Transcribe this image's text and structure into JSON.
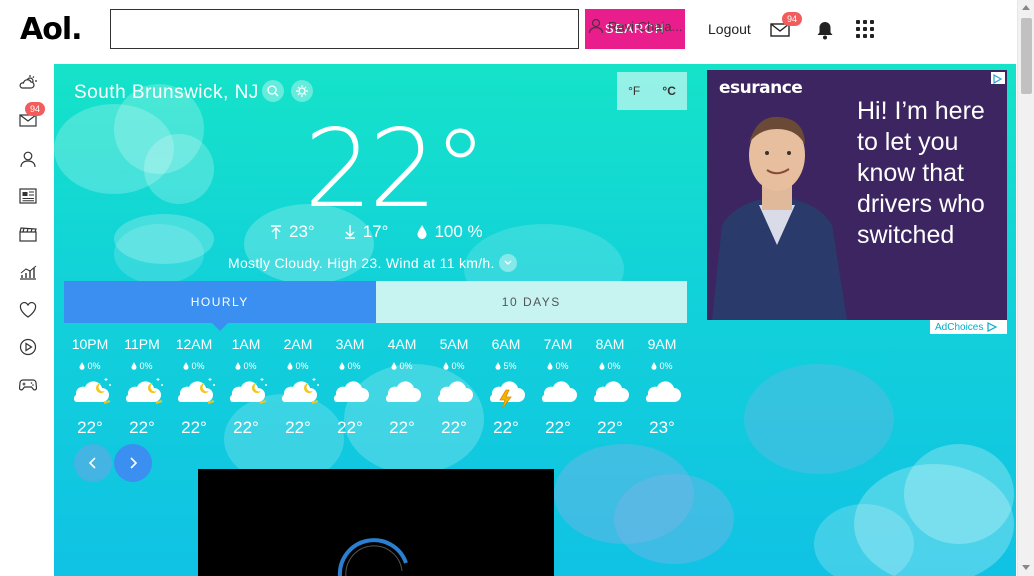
{
  "header": {
    "logo": "Aol.",
    "search_placeholder": "",
    "search_button": "SEARCH",
    "user_name": "Ravi Chaja...",
    "logout": "Logout",
    "mail_count": "94"
  },
  "leftnav": {
    "items": [
      {
        "name": "weather-icon"
      },
      {
        "name": "mail-icon",
        "badge": "94"
      },
      {
        "name": "user-icon"
      },
      {
        "name": "news-icon"
      },
      {
        "name": "entertainment-icon"
      },
      {
        "name": "finance-icon"
      },
      {
        "name": "lifestyle-icon"
      },
      {
        "name": "video-icon"
      },
      {
        "name": "games-icon"
      }
    ]
  },
  "weather": {
    "location": "South Brunswick, NJ",
    "unit_f": "°F",
    "unit_c": "°C",
    "temp": "22°",
    "high": "23°",
    "low": "17°",
    "humidity": "100 %",
    "summary": "Mostly Cloudy. High 23. Wind at 11 km/h.",
    "tabs": [
      {
        "label": "HOURLY",
        "active": true
      },
      {
        "label": "10 DAYS",
        "active": false
      }
    ],
    "hourly": [
      {
        "time": "10PM",
        "precip": "0%",
        "icon": "partly-cloudy-night",
        "temp": "22°"
      },
      {
        "time": "11PM",
        "precip": "0%",
        "icon": "partly-cloudy-night",
        "temp": "22°"
      },
      {
        "time": "12AM",
        "precip": "0%",
        "icon": "partly-cloudy-night",
        "temp": "22°"
      },
      {
        "time": "1AM",
        "precip": "0%",
        "icon": "partly-cloudy-night",
        "temp": "22°"
      },
      {
        "time": "2AM",
        "precip": "0%",
        "icon": "partly-cloudy-night",
        "temp": "22°"
      },
      {
        "time": "3AM",
        "precip": "0%",
        "icon": "cloudy",
        "temp": "22°"
      },
      {
        "time": "4AM",
        "precip": "0%",
        "icon": "cloudy",
        "temp": "22°"
      },
      {
        "time": "5AM",
        "precip": "0%",
        "icon": "cloudy",
        "temp": "22°"
      },
      {
        "time": "6AM",
        "precip": "5%",
        "icon": "thunderstorm",
        "temp": "22°"
      },
      {
        "time": "7AM",
        "precip": "0%",
        "icon": "cloudy",
        "temp": "22°"
      },
      {
        "time": "8AM",
        "precip": "0%",
        "icon": "cloudy",
        "temp": "22°"
      },
      {
        "time": "9AM",
        "precip": "0%",
        "icon": "cloudy",
        "temp": "23°"
      }
    ]
  },
  "ad": {
    "brand": "esurance",
    "text": "Hi! I’m here to let you know that drivers who switched",
    "adchoices": "AdChoices"
  },
  "colors": {
    "accent": "#3a8ff0",
    "search_button": "#e91e8c",
    "badge": "#f25c5c",
    "ad_bg": "#3d2561"
  }
}
